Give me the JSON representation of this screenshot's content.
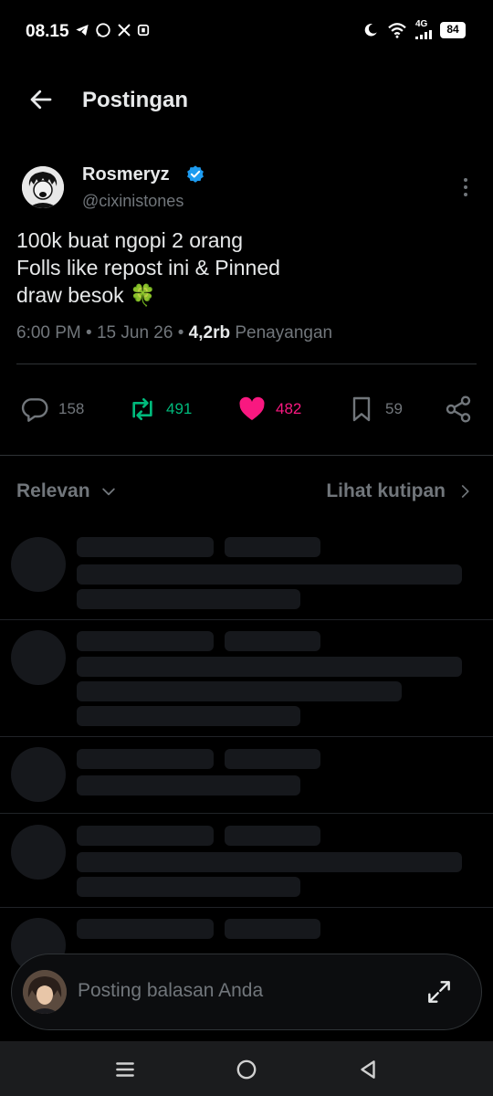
{
  "status_bar": {
    "time": "08.15",
    "left_icons": [
      "telegram-icon",
      "whatsapp-icon",
      "x-icon",
      "app-icon"
    ],
    "network": "4G",
    "battery": "84",
    "right_icons": [
      "moon-icon",
      "wifi-icon",
      "signal-icon",
      "battery-icon"
    ]
  },
  "header": {
    "title": "Postingan",
    "back_icon": "arrow-left-icon"
  },
  "post": {
    "author_name": "Rosmeryz",
    "handle": "@cixinistones",
    "verified": true,
    "text_lines": [
      "100k buat ngopi 2 orang",
      "Folls like repost ini & Pinned",
      "draw besok 🍀"
    ],
    "time": "6:00 PM",
    "date": "15 Jun 26",
    "views_count": "4,2rb",
    "views_label": "Penayangan"
  },
  "actions": {
    "replies": "158",
    "reposts": "491",
    "likes": "482",
    "bookmarks": "59"
  },
  "replies_section": {
    "sort_label": "Relevan",
    "quotes_link": "Lihat kutipan"
  },
  "composer": {
    "placeholder": "Posting balasan Anda"
  },
  "colors": {
    "background": "#000000",
    "text": "#e7e9ea",
    "muted": "#71767b",
    "verified": "#1d9bf0",
    "repost": "#00ba7c",
    "like": "#f91880",
    "skeleton": "#16181c"
  }
}
